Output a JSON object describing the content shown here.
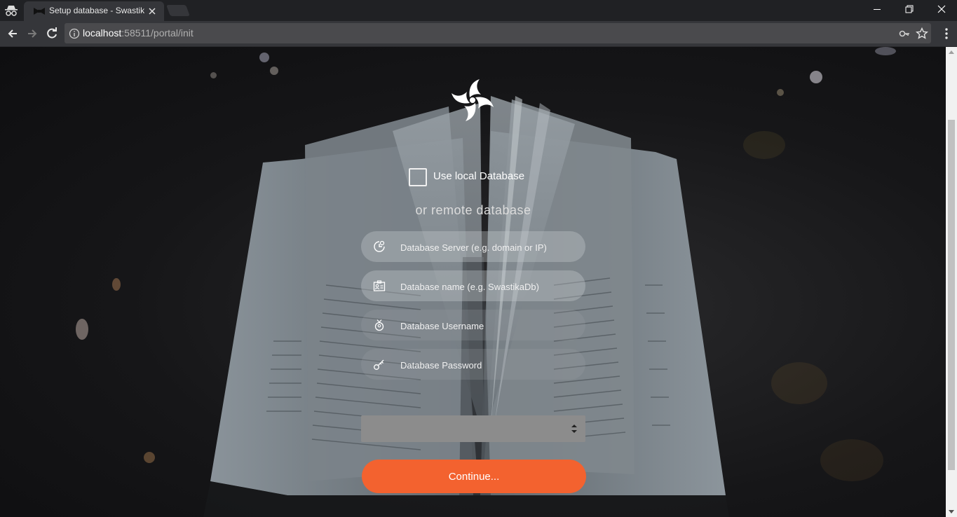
{
  "browser": {
    "tab_title": "Setup database - Swastika",
    "url_host": "localhost",
    "url_rest": ":58511/portal/init"
  },
  "form": {
    "use_local_label": "Use local Database",
    "or_remote_label": "or remote database",
    "server_placeholder": "Database Server (e.g. domain or IP)",
    "name_placeholder": "Database name (e.g. SwastikaDb)",
    "username_placeholder": "Database Username",
    "password_placeholder": "Database Password",
    "provider_selected": "",
    "continue_label": "Continue..."
  },
  "colors": {
    "accent": "#f3622f",
    "chrome_dark": "#202124",
    "toolbar": "#35363a"
  },
  "icons": {
    "logo": "swastika-logo-icon",
    "server": "server-icon",
    "name": "id-card-icon",
    "username": "user-icon",
    "password": "key-icon"
  }
}
